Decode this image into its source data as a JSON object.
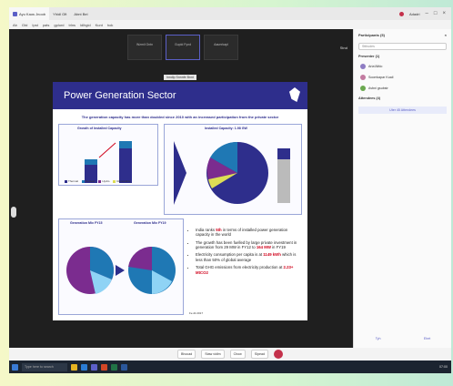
{
  "titlebar": {
    "tab1": "Ayu Kaos Jnoob",
    "tab2": "Yhidl Gft",
    "tab3": "Abnt Bei",
    "user": "Adadri",
    "rec": "",
    "min": "–",
    "max": "□",
    "close": "×"
  },
  "menubar": {
    "items": [
      "Ab",
      "Gtd",
      "Ipst",
      "pats",
      "gplurd",
      "trlns",
      "ldlhgid",
      "Kunt",
      "hok"
    ]
  },
  "meeting": {
    "thumbs": [
      "Wzmil Gntn",
      "Gupld Fynd",
      "Aaunrkapl"
    ],
    "share": "Stnd",
    "presenter": "Inndlp Snnnfe Bnnt"
  },
  "slide": {
    "title": "Power Generation Sector",
    "subtitle": "The generation capacity has more than doubled since 2010 with an increased participation from the private sector",
    "panel1_title": "Growth of Installed Capacity",
    "panel2_title": "Installed Capacity: 1.98 GW",
    "panel3_title": "Generation Mix FY15",
    "panel4_title": "Generation Mix FY19",
    "legend": [
      "Thermal",
      "Nuclear",
      "Hydro",
      "Renewable"
    ],
    "bullets": [
      {
        "pre": "India ranks ",
        "hl": "5th",
        "post": " in terms of installed power generation capacity in the world"
      },
      {
        "pre": "The growth has been fuelled by large private investment in generation from 29 MW in FY12 to ",
        "hl": "164 MW",
        "post": " in FY19"
      },
      {
        "pre": "Electricity consumption per capita is at ",
        "hl": "1149 kWh",
        "post": " which is less than 50% of global average"
      },
      {
        "pre": "Total GHG emissions from electricity production at ",
        "hl": "2.23+ MtCO2",
        "post": ""
      }
    ],
    "footer": "Fe dit 2017"
  },
  "participants": {
    "title": "Participants (5)",
    "search": "Stthudes",
    "presenters_label": "Presenter (1)",
    "attendees_label": "Attendees (4)",
    "rows": [
      "Ariz/Alfdo",
      "Soomkapar Kuail",
      "Avbni gsubstr"
    ],
    "link": "Uter 45 Attendees",
    "bottom_left": "Tyh",
    "bottom_right": "Ehet"
  },
  "toolbar": [
    "Bhocad",
    "Staw vidlm",
    "Chow",
    "Slpead"
  ],
  "taskbar": {
    "search": "Type here to search",
    "time": "07:00"
  },
  "colors": {
    "slide_header": "#2e2e8c",
    "thermal": "#2e2e8c",
    "nuclear": "#1f78b4",
    "hydro": "#7b2c8f",
    "renewable": "#dddd55"
  }
}
